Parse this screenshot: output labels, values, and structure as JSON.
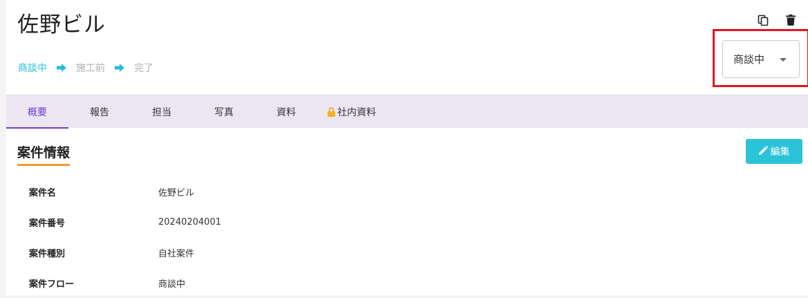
{
  "header": {
    "title": "佐野ビル",
    "actions": [
      {
        "name": "copy-icon"
      },
      {
        "name": "trash-icon"
      }
    ]
  },
  "flow": {
    "steps": [
      {
        "label": "商談中",
        "active": true
      },
      {
        "label": "施工前",
        "active": false
      },
      {
        "label": "完了",
        "active": false
      }
    ],
    "active_color": "#26bcd4",
    "inactive_color": "#b0b0b0"
  },
  "status_select": {
    "value": "商談中"
  },
  "tabs": [
    {
      "label": "概要",
      "active": true
    },
    {
      "label": "報告",
      "active": false
    },
    {
      "label": "担当",
      "active": false
    },
    {
      "label": "写真",
      "active": false
    },
    {
      "label": "資料",
      "active": false
    },
    {
      "label": "社内資料",
      "active": false,
      "icon": "lock-icon"
    }
  ],
  "section": {
    "title": "案件情報",
    "edit_label": "編集"
  },
  "info": [
    {
      "key": "案件名",
      "value": "佐野ビル"
    },
    {
      "key": "案件番号",
      "value": "20240204001"
    },
    {
      "key": "案件種別",
      "value": "自社案件"
    },
    {
      "key": "案件フロー",
      "value": "商談中"
    }
  ],
  "colors": {
    "accent": "#6c3ec9",
    "tab_bg": "#ece6f3",
    "button": "#2bc3d8",
    "underline": "#f39a2d",
    "highlight": "#e3131f"
  }
}
